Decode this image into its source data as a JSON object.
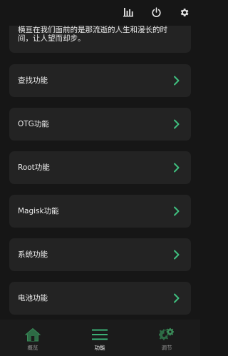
{
  "header": {
    "icons": [
      "bar-chart-icon",
      "power-icon",
      "gear-icon"
    ]
  },
  "intro": {
    "line1": "横亘在我们面前的是那流逝的人生和漫长的时",
    "line2": "间，让人望而却步。"
  },
  "menu": {
    "items": [
      {
        "label": "查找功能"
      },
      {
        "label": "OTG功能"
      },
      {
        "label": "Root功能"
      },
      {
        "label": "Magisk功能"
      },
      {
        "label": "系统功能"
      },
      {
        "label": "电池功能"
      }
    ]
  },
  "bottom_nav": {
    "items": [
      {
        "label": "概览",
        "icon": "home-icon",
        "active": false
      },
      {
        "label": "功能",
        "icon": "menu-icon",
        "active": true
      },
      {
        "label": "调节",
        "icon": "gears-icon",
        "active": false
      }
    ]
  },
  "colors": {
    "accent": "#3fbf7f",
    "background": "#161616",
    "card": "#232323"
  }
}
